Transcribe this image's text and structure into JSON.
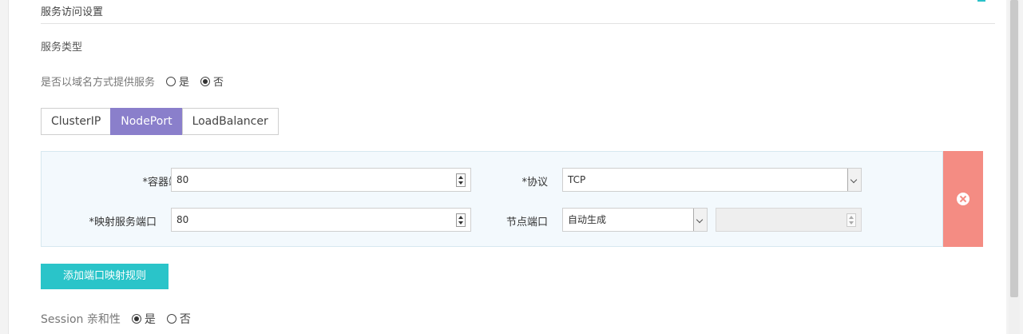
{
  "section": {
    "title": "服务访问设置"
  },
  "service_type": {
    "label": "服务类型",
    "domain_question": "是否以域名方式提供服务",
    "domain_options": [
      {
        "label": "是",
        "checked": false
      },
      {
        "label": "否",
        "checked": true
      }
    ],
    "tabs": [
      {
        "label": "ClusterIP",
        "active": false
      },
      {
        "label": "NodePort",
        "active": true
      },
      {
        "label": "LoadBalancer",
        "active": false
      }
    ]
  },
  "port_rule": {
    "container_port_label": "*容器端口",
    "container_port_value": "80",
    "protocol_label": "*协议",
    "protocol_value": "TCP",
    "mapped_port_label": "*映射服务端口",
    "mapped_port_value": "80",
    "node_port_label": "节点端口",
    "node_port_mode": "自动生成",
    "node_port_value": ""
  },
  "add_rule_button": "添加端口映射规则",
  "session": {
    "label": "Session 亲和性",
    "options": [
      {
        "label": "是",
        "checked": true
      },
      {
        "label": "否",
        "checked": false
      }
    ]
  },
  "colors": {
    "accent_teal": "#2ac4c9",
    "tab_active": "#8a7fcb",
    "delete_red": "#f48c83",
    "rule_bg": "#f3f9fd"
  }
}
